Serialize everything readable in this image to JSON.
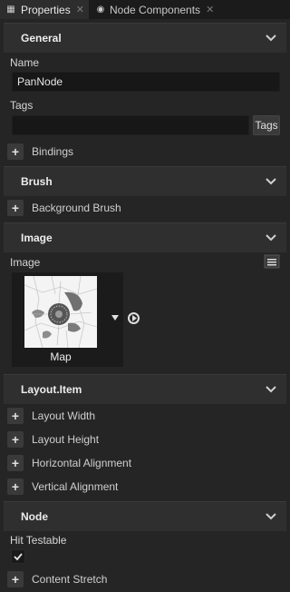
{
  "tabs": [
    {
      "label": "Properties",
      "icon": "properties-icon",
      "active": true
    },
    {
      "label": "Node Components",
      "icon": "components-icon",
      "active": false
    }
  ],
  "sections": {
    "general": {
      "title": "General",
      "name_label": "Name",
      "name_value": "PanNode",
      "tags_label": "Tags",
      "tags_value": "",
      "tags_button": "Tags",
      "bindings_label": "Bindings"
    },
    "brush": {
      "title": "Brush",
      "background_brush_label": "Background Brush"
    },
    "image": {
      "title": "Image",
      "image_label": "Image",
      "thumbnail_caption": "Map"
    },
    "layout_item": {
      "title": "Layout.Item",
      "items": [
        "Layout Width",
        "Layout Height",
        "Horizontal Alignment",
        "Vertical Alignment"
      ]
    },
    "node": {
      "title": "Node",
      "hit_testable_label": "Hit Testable",
      "hit_testable_checked": true,
      "content_stretch_label": "Content Stretch"
    }
  },
  "colors": {
    "panel_bg": "#252526",
    "header_bg": "#2f2f30",
    "input_bg": "#171717",
    "button_bg": "#3a3a3a"
  }
}
